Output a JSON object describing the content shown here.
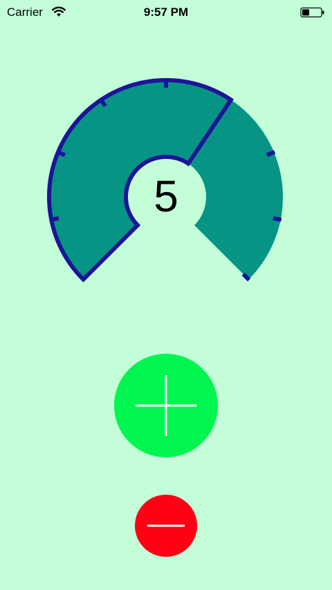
{
  "status_bar": {
    "carrier": "Carrier",
    "time": "9:57 PM",
    "icons": [
      "wifi-icon",
      "battery-icon"
    ]
  },
  "gauge": {
    "value": "5",
    "level": 5,
    "max": 8,
    "fill_color": "#069584",
    "stroke_color": "#1C1499"
  },
  "controls": {
    "plus_icon": "plus-icon",
    "minus_icon": "minus-icon"
  },
  "colors": {
    "background": "#C3FED9",
    "plus_button": "#00F64E",
    "minus_button": "#FF0014",
    "icon_stroke": "#FFFFFF"
  }
}
